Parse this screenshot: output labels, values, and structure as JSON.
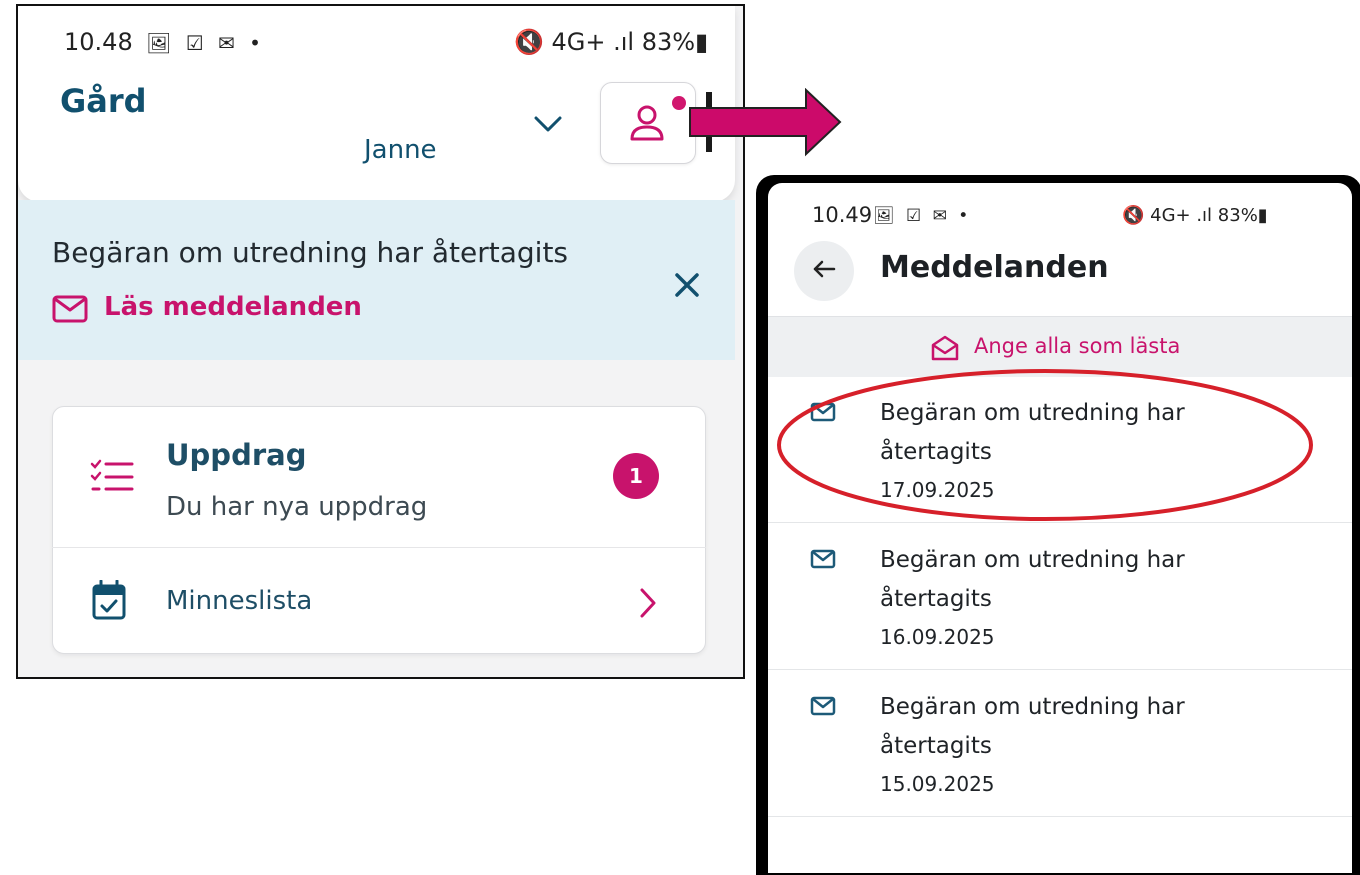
{
  "screen1": {
    "status_bar": {
      "time": "10.48",
      "indicators": "🖼 ☑ ✉ •",
      "right": "🔇 4G+ .ıl 83%▮"
    },
    "header": {
      "farm_label": "Gård",
      "user_name": "Janne",
      "chevron_icon": "chevron-down-icon",
      "profile_icon": "person-icon"
    },
    "banner": {
      "title": "Begäran om utredning har återtagits",
      "link_label": "Läs meddelanden"
    },
    "tasks_card": {
      "title": "Uppdrag",
      "subtitle": "Du har nya uppdrag",
      "badge_count": "1",
      "reminder_label": "Minneslista"
    }
  },
  "screen2": {
    "status_bar": {
      "time": "10.49",
      "indicators": "🖼 ☑ ✉ •",
      "right": "🔇 4G+ .ıl 83%▮"
    },
    "title": "Meddelanden",
    "mark_all_read": "Ange alla som lästa",
    "messages": [
      {
        "title": "Begäran om utredning har återtagits",
        "date": "17.09.2025"
      },
      {
        "title": "Begäran om utredning har återtagits",
        "date": "16.09.2025"
      },
      {
        "title": "Begäran om utredning har återtagits",
        "date": "15.09.2025"
      }
    ]
  },
  "colors": {
    "accent_pink": "#c8136c",
    "header_blue": "#11506e",
    "banner_bg": "#e0eff5",
    "highlight_red": "#d6202a"
  }
}
